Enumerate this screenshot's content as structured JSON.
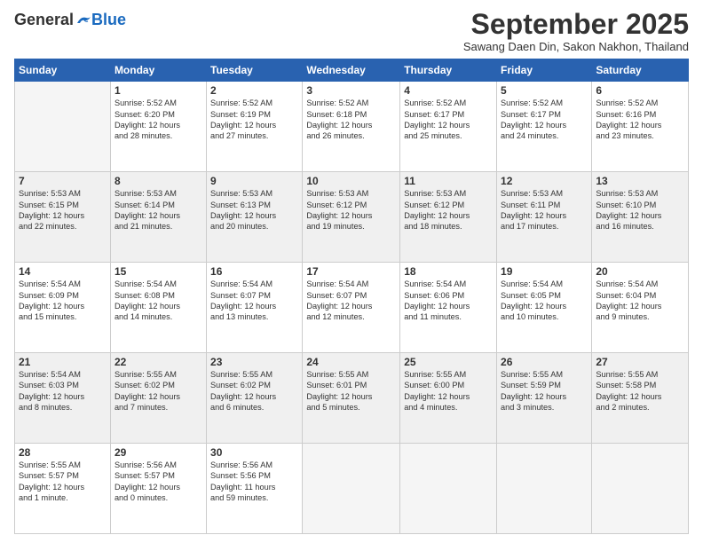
{
  "header": {
    "logo_general": "General",
    "logo_blue": "Blue",
    "month": "September 2025",
    "location": "Sawang Daen Din, Sakon Nakhon, Thailand"
  },
  "weekdays": [
    "Sunday",
    "Monday",
    "Tuesday",
    "Wednesday",
    "Thursday",
    "Friday",
    "Saturday"
  ],
  "weeks": [
    [
      {
        "day": "",
        "info": ""
      },
      {
        "day": "1",
        "info": "Sunrise: 5:52 AM\nSunset: 6:20 PM\nDaylight: 12 hours\nand 28 minutes."
      },
      {
        "day": "2",
        "info": "Sunrise: 5:52 AM\nSunset: 6:19 PM\nDaylight: 12 hours\nand 27 minutes."
      },
      {
        "day": "3",
        "info": "Sunrise: 5:52 AM\nSunset: 6:18 PM\nDaylight: 12 hours\nand 26 minutes."
      },
      {
        "day": "4",
        "info": "Sunrise: 5:52 AM\nSunset: 6:17 PM\nDaylight: 12 hours\nand 25 minutes."
      },
      {
        "day": "5",
        "info": "Sunrise: 5:52 AM\nSunset: 6:17 PM\nDaylight: 12 hours\nand 24 minutes."
      },
      {
        "day": "6",
        "info": "Sunrise: 5:52 AM\nSunset: 6:16 PM\nDaylight: 12 hours\nand 23 minutes."
      }
    ],
    [
      {
        "day": "7",
        "info": "Sunrise: 5:53 AM\nSunset: 6:15 PM\nDaylight: 12 hours\nand 22 minutes."
      },
      {
        "day": "8",
        "info": "Sunrise: 5:53 AM\nSunset: 6:14 PM\nDaylight: 12 hours\nand 21 minutes."
      },
      {
        "day": "9",
        "info": "Sunrise: 5:53 AM\nSunset: 6:13 PM\nDaylight: 12 hours\nand 20 minutes."
      },
      {
        "day": "10",
        "info": "Sunrise: 5:53 AM\nSunset: 6:12 PM\nDaylight: 12 hours\nand 19 minutes."
      },
      {
        "day": "11",
        "info": "Sunrise: 5:53 AM\nSunset: 6:12 PM\nDaylight: 12 hours\nand 18 minutes."
      },
      {
        "day": "12",
        "info": "Sunrise: 5:53 AM\nSunset: 6:11 PM\nDaylight: 12 hours\nand 17 minutes."
      },
      {
        "day": "13",
        "info": "Sunrise: 5:53 AM\nSunset: 6:10 PM\nDaylight: 12 hours\nand 16 minutes."
      }
    ],
    [
      {
        "day": "14",
        "info": "Sunrise: 5:54 AM\nSunset: 6:09 PM\nDaylight: 12 hours\nand 15 minutes."
      },
      {
        "day": "15",
        "info": "Sunrise: 5:54 AM\nSunset: 6:08 PM\nDaylight: 12 hours\nand 14 minutes."
      },
      {
        "day": "16",
        "info": "Sunrise: 5:54 AM\nSunset: 6:07 PM\nDaylight: 12 hours\nand 13 minutes."
      },
      {
        "day": "17",
        "info": "Sunrise: 5:54 AM\nSunset: 6:07 PM\nDaylight: 12 hours\nand 12 minutes."
      },
      {
        "day": "18",
        "info": "Sunrise: 5:54 AM\nSunset: 6:06 PM\nDaylight: 12 hours\nand 11 minutes."
      },
      {
        "day": "19",
        "info": "Sunrise: 5:54 AM\nSunset: 6:05 PM\nDaylight: 12 hours\nand 10 minutes."
      },
      {
        "day": "20",
        "info": "Sunrise: 5:54 AM\nSunset: 6:04 PM\nDaylight: 12 hours\nand 9 minutes."
      }
    ],
    [
      {
        "day": "21",
        "info": "Sunrise: 5:54 AM\nSunset: 6:03 PM\nDaylight: 12 hours\nand 8 minutes."
      },
      {
        "day": "22",
        "info": "Sunrise: 5:55 AM\nSunset: 6:02 PM\nDaylight: 12 hours\nand 7 minutes."
      },
      {
        "day": "23",
        "info": "Sunrise: 5:55 AM\nSunset: 6:02 PM\nDaylight: 12 hours\nand 6 minutes."
      },
      {
        "day": "24",
        "info": "Sunrise: 5:55 AM\nSunset: 6:01 PM\nDaylight: 12 hours\nand 5 minutes."
      },
      {
        "day": "25",
        "info": "Sunrise: 5:55 AM\nSunset: 6:00 PM\nDaylight: 12 hours\nand 4 minutes."
      },
      {
        "day": "26",
        "info": "Sunrise: 5:55 AM\nSunset: 5:59 PM\nDaylight: 12 hours\nand 3 minutes."
      },
      {
        "day": "27",
        "info": "Sunrise: 5:55 AM\nSunset: 5:58 PM\nDaylight: 12 hours\nand 2 minutes."
      }
    ],
    [
      {
        "day": "28",
        "info": "Sunrise: 5:55 AM\nSunset: 5:57 PM\nDaylight: 12 hours\nand 1 minute."
      },
      {
        "day": "29",
        "info": "Sunrise: 5:56 AM\nSunset: 5:57 PM\nDaylight: 12 hours\nand 0 minutes."
      },
      {
        "day": "30",
        "info": "Sunrise: 5:56 AM\nSunset: 5:56 PM\nDaylight: 11 hours\nand 59 minutes."
      },
      {
        "day": "",
        "info": ""
      },
      {
        "day": "",
        "info": ""
      },
      {
        "day": "",
        "info": ""
      },
      {
        "day": "",
        "info": ""
      }
    ]
  ]
}
